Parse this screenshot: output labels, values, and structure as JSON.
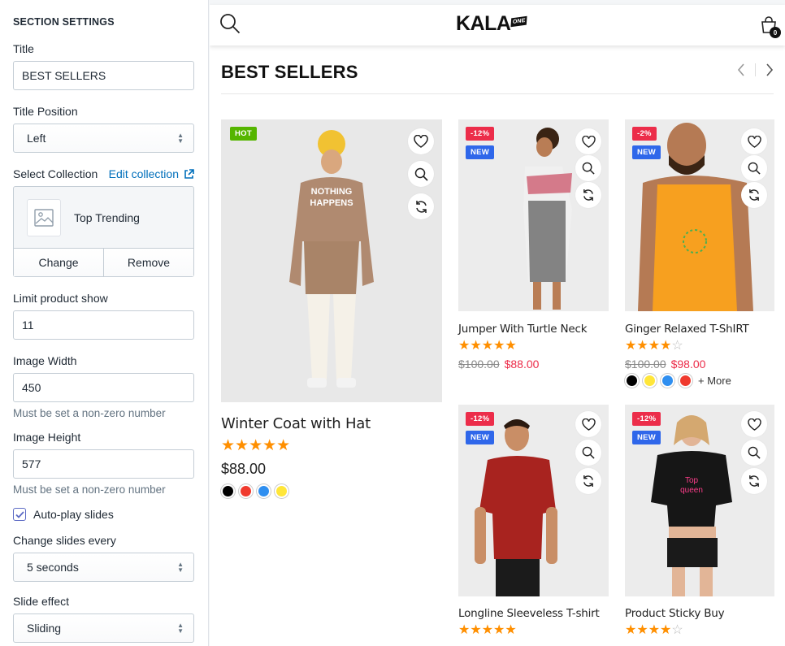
{
  "settings": {
    "header": "SECTION SETTINGS",
    "title_label": "Title",
    "title_value": "BEST SELLERS",
    "title_position_label": "Title Position",
    "title_position_value": "Left",
    "select_collection_label": "Select Collection",
    "edit_collection_link": "Edit collection",
    "collection_name": "Top Trending",
    "change_button": "Change",
    "remove_button": "Remove",
    "limit_label": "Limit product show",
    "limit_value": "11",
    "image_width_label": "Image Width",
    "image_width_value": "450",
    "image_width_help": "Must be set a non-zero number",
    "image_height_label": "Image Height",
    "image_height_value": "577",
    "image_height_help": "Must be set a non-zero number",
    "autoplay_label": "Auto-play slides",
    "autoplay_checked": true,
    "change_every_label": "Change slides every",
    "change_every_value": "5 seconds",
    "slide_effect_label": "Slide effect",
    "slide_effect_value": "Sliding"
  },
  "store": {
    "logo_text": "KALA",
    "logo_badge": "ONE",
    "cart_count": "0",
    "section_title": "BEST SELLERS"
  },
  "products": [
    {
      "name": "Winter Coat with Hat",
      "badges": [
        "HOT"
      ],
      "price": "$88.00",
      "rating": 5,
      "swatches": [
        "#000000",
        "#f03a2e",
        "#2f8ff0",
        "#ffe63a"
      ]
    },
    {
      "name": "Jumper With Turtle Neck",
      "badges": [
        "-12%",
        "NEW"
      ],
      "old_price": "$100.00",
      "price": "$88.00",
      "rating": 5
    },
    {
      "name": "Ginger Relaxed T-ShIRT",
      "badges": [
        "-2%",
        "NEW"
      ],
      "old_price": "$100.00",
      "price": "$98.00",
      "rating": 4,
      "swatches": [
        "#000000",
        "#ffe63a",
        "#2f8ff0",
        "#f03a2e"
      ],
      "more_label": "+ More"
    },
    {
      "name": "Longline Sleeveless T-shirt",
      "badges": [
        "-12%",
        "NEW"
      ],
      "rating": 5
    },
    {
      "name": "Product Sticky Buy",
      "badges": [
        "-12%",
        "NEW"
      ],
      "rating": 4
    }
  ],
  "colors": {
    "hot": "#55b500",
    "sale": "#ec2d4a",
    "new": "#2f67ea",
    "star": "#ff8f00",
    "link": "#006fbb"
  },
  "icons": [
    "search-icon",
    "cart-icon",
    "heart-icon",
    "zoom-icon",
    "compare-icon",
    "image-placeholder-icon",
    "external-link-icon",
    "chevron-left-icon",
    "chevron-right-icon",
    "select-caret-icon",
    "checkmark-icon"
  ]
}
